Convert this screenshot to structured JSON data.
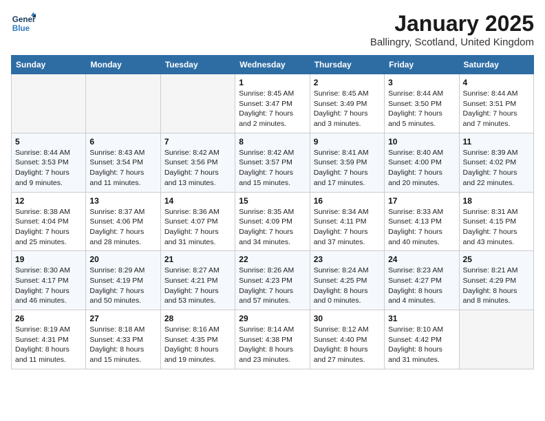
{
  "header": {
    "logo_line1": "General",
    "logo_line2": "Blue",
    "month": "January 2025",
    "location": "Ballingry, Scotland, United Kingdom"
  },
  "weekdays": [
    "Sunday",
    "Monday",
    "Tuesday",
    "Wednesday",
    "Thursday",
    "Friday",
    "Saturday"
  ],
  "weeks": [
    [
      {
        "day": "",
        "sunrise": "",
        "sunset": "",
        "daylight": ""
      },
      {
        "day": "",
        "sunrise": "",
        "sunset": "",
        "daylight": ""
      },
      {
        "day": "",
        "sunrise": "",
        "sunset": "",
        "daylight": ""
      },
      {
        "day": "1",
        "sunrise": "Sunrise: 8:45 AM",
        "sunset": "Sunset: 3:47 PM",
        "daylight": "Daylight: 7 hours and 2 minutes."
      },
      {
        "day": "2",
        "sunrise": "Sunrise: 8:45 AM",
        "sunset": "Sunset: 3:49 PM",
        "daylight": "Daylight: 7 hours and 3 minutes."
      },
      {
        "day": "3",
        "sunrise": "Sunrise: 8:44 AM",
        "sunset": "Sunset: 3:50 PM",
        "daylight": "Daylight: 7 hours and 5 minutes."
      },
      {
        "day": "4",
        "sunrise": "Sunrise: 8:44 AM",
        "sunset": "Sunset: 3:51 PM",
        "daylight": "Daylight: 7 hours and 7 minutes."
      }
    ],
    [
      {
        "day": "5",
        "sunrise": "Sunrise: 8:44 AM",
        "sunset": "Sunset: 3:53 PM",
        "daylight": "Daylight: 7 hours and 9 minutes."
      },
      {
        "day": "6",
        "sunrise": "Sunrise: 8:43 AM",
        "sunset": "Sunset: 3:54 PM",
        "daylight": "Daylight: 7 hours and 11 minutes."
      },
      {
        "day": "7",
        "sunrise": "Sunrise: 8:42 AM",
        "sunset": "Sunset: 3:56 PM",
        "daylight": "Daylight: 7 hours and 13 minutes."
      },
      {
        "day": "8",
        "sunrise": "Sunrise: 8:42 AM",
        "sunset": "Sunset: 3:57 PM",
        "daylight": "Daylight: 7 hours and 15 minutes."
      },
      {
        "day": "9",
        "sunrise": "Sunrise: 8:41 AM",
        "sunset": "Sunset: 3:59 PM",
        "daylight": "Daylight: 7 hours and 17 minutes."
      },
      {
        "day": "10",
        "sunrise": "Sunrise: 8:40 AM",
        "sunset": "Sunset: 4:00 PM",
        "daylight": "Daylight: 7 hours and 20 minutes."
      },
      {
        "day": "11",
        "sunrise": "Sunrise: 8:39 AM",
        "sunset": "Sunset: 4:02 PM",
        "daylight": "Daylight: 7 hours and 22 minutes."
      }
    ],
    [
      {
        "day": "12",
        "sunrise": "Sunrise: 8:38 AM",
        "sunset": "Sunset: 4:04 PM",
        "daylight": "Daylight: 7 hours and 25 minutes."
      },
      {
        "day": "13",
        "sunrise": "Sunrise: 8:37 AM",
        "sunset": "Sunset: 4:06 PM",
        "daylight": "Daylight: 7 hours and 28 minutes."
      },
      {
        "day": "14",
        "sunrise": "Sunrise: 8:36 AM",
        "sunset": "Sunset: 4:07 PM",
        "daylight": "Daylight: 7 hours and 31 minutes."
      },
      {
        "day": "15",
        "sunrise": "Sunrise: 8:35 AM",
        "sunset": "Sunset: 4:09 PM",
        "daylight": "Daylight: 7 hours and 34 minutes."
      },
      {
        "day": "16",
        "sunrise": "Sunrise: 8:34 AM",
        "sunset": "Sunset: 4:11 PM",
        "daylight": "Daylight: 7 hours and 37 minutes."
      },
      {
        "day": "17",
        "sunrise": "Sunrise: 8:33 AM",
        "sunset": "Sunset: 4:13 PM",
        "daylight": "Daylight: 7 hours and 40 minutes."
      },
      {
        "day": "18",
        "sunrise": "Sunrise: 8:31 AM",
        "sunset": "Sunset: 4:15 PM",
        "daylight": "Daylight: 7 hours and 43 minutes."
      }
    ],
    [
      {
        "day": "19",
        "sunrise": "Sunrise: 8:30 AM",
        "sunset": "Sunset: 4:17 PM",
        "daylight": "Daylight: 7 hours and 46 minutes."
      },
      {
        "day": "20",
        "sunrise": "Sunrise: 8:29 AM",
        "sunset": "Sunset: 4:19 PM",
        "daylight": "Daylight: 7 hours and 50 minutes."
      },
      {
        "day": "21",
        "sunrise": "Sunrise: 8:27 AM",
        "sunset": "Sunset: 4:21 PM",
        "daylight": "Daylight: 7 hours and 53 minutes."
      },
      {
        "day": "22",
        "sunrise": "Sunrise: 8:26 AM",
        "sunset": "Sunset: 4:23 PM",
        "daylight": "Daylight: 7 hours and 57 minutes."
      },
      {
        "day": "23",
        "sunrise": "Sunrise: 8:24 AM",
        "sunset": "Sunset: 4:25 PM",
        "daylight": "Daylight: 8 hours and 0 minutes."
      },
      {
        "day": "24",
        "sunrise": "Sunrise: 8:23 AM",
        "sunset": "Sunset: 4:27 PM",
        "daylight": "Daylight: 8 hours and 4 minutes."
      },
      {
        "day": "25",
        "sunrise": "Sunrise: 8:21 AM",
        "sunset": "Sunset: 4:29 PM",
        "daylight": "Daylight: 8 hours and 8 minutes."
      }
    ],
    [
      {
        "day": "26",
        "sunrise": "Sunrise: 8:19 AM",
        "sunset": "Sunset: 4:31 PM",
        "daylight": "Daylight: 8 hours and 11 minutes."
      },
      {
        "day": "27",
        "sunrise": "Sunrise: 8:18 AM",
        "sunset": "Sunset: 4:33 PM",
        "daylight": "Daylight: 8 hours and 15 minutes."
      },
      {
        "day": "28",
        "sunrise": "Sunrise: 8:16 AM",
        "sunset": "Sunset: 4:35 PM",
        "daylight": "Daylight: 8 hours and 19 minutes."
      },
      {
        "day": "29",
        "sunrise": "Sunrise: 8:14 AM",
        "sunset": "Sunset: 4:38 PM",
        "daylight": "Daylight: 8 hours and 23 minutes."
      },
      {
        "day": "30",
        "sunrise": "Sunrise: 8:12 AM",
        "sunset": "Sunset: 4:40 PM",
        "daylight": "Daylight: 8 hours and 27 minutes."
      },
      {
        "day": "31",
        "sunrise": "Sunrise: 8:10 AM",
        "sunset": "Sunset: 4:42 PM",
        "daylight": "Daylight: 8 hours and 31 minutes."
      },
      {
        "day": "",
        "sunrise": "",
        "sunset": "",
        "daylight": ""
      }
    ]
  ]
}
